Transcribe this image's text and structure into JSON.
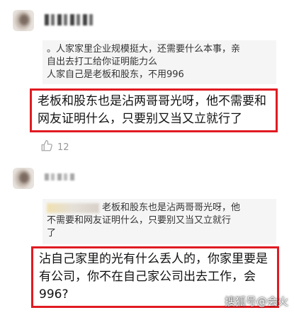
{
  "comments": [
    {
      "quote_lines": [
        "。人家家里企业规模挺大，还需要什么本事，亲",
        "自出去打工给你证明能力么",
        "人家自己是老板和股东，不用996"
      ],
      "reply_lines": [
        "老板和股东也是沾两哥哥光呀，他不需要和",
        "网友证明什么，只要别又当又立就行了"
      ],
      "likes": "12"
    },
    {
      "quote_lines": [
        "老板和股东也是沾两哥哥光呀，他",
        "不需要和网友证明什么，只要别又当又立就行",
        "了"
      ],
      "reply_lines": [
        "沾自己家里的光有什么丢人的，你家里要是",
        "有公司，你不在自己家公司出去工作，会",
        "996?"
      ]
    }
  ],
  "watermark": "搜狐号@会火",
  "icons": {
    "like": "thumbs-up-icon"
  },
  "colors": {
    "highlight_border": "#e01b22",
    "quote_bg": "#f5f5f5"
  }
}
